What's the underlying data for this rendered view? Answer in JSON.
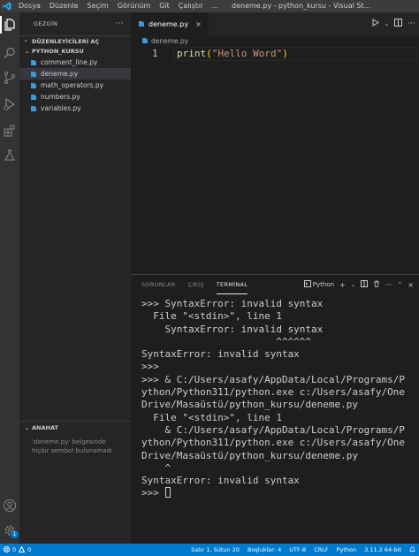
{
  "titlebar": {
    "menu": [
      "Dosya",
      "Düzenle",
      "Seçim",
      "Görünüm",
      "Git",
      "Çalıştır",
      "..."
    ],
    "window_title": "deneme.py - python_kursu - Visual St..."
  },
  "activity": {
    "icons": [
      "files-icon",
      "search-icon",
      "source-control-icon",
      "run-debug-icon",
      "extensions-icon",
      "testing-icon"
    ],
    "bottom_icons": [
      "account-icon",
      "settings-icon"
    ],
    "settings_badge": "1"
  },
  "sidebar": {
    "title": "GEZGİN",
    "more": "···",
    "open_editors": "DÜZENLEYİCİLERİ AÇ",
    "folder": "PYTHON_KURSU",
    "files": [
      "comment_line.py",
      "deneme.py",
      "math_operators.py",
      "numbers.py",
      "variables.py"
    ],
    "active_index": 1,
    "outline": {
      "title": "ANAHAT",
      "message": "'deneme.py' belgesinde hiçbir sembol bulunamadı"
    }
  },
  "editor": {
    "tab": "deneme.py",
    "tab_close": "×",
    "breadcrumb": "deneme.py",
    "line_number": "1",
    "code": {
      "fn": "print",
      "open": "(",
      "str": "\"Hello Word\"",
      "close": ")"
    }
  },
  "panel": {
    "tabs": [
      "SORUNLAR",
      "ÇIKIŞ",
      "TERMİNAL"
    ],
    "active_tab": 2,
    "shell": "Python",
    "terminal_lines": [
      ">>> SyntaxError: invalid syntax",
      "  File \"<stdin>\", line 1",
      "    SyntaxError: invalid syntax",
      "                       ^^^^^^",
      "SyntaxError: invalid syntax",
      ">>>",
      ">>> & C:/Users/asafy/AppData/Local/Programs/P",
      "ython/Python311/python.exe c:/Users/asafy/One",
      "Drive/Masaüstü/python_kursu/deneme.py",
      "  File \"<stdin>\", line 1",
      "    & C:/Users/asafy/AppData/Local/Programs/P",
      "ython/Python311/python.exe c:/Users/asafy/One",
      "Drive/Masaüstü/python_kursu/deneme.py",
      "    ^",
      "SyntaxError: invalid syntax"
    ],
    "prompt": ">>> "
  },
  "status": {
    "errors": "0",
    "warnings": "0",
    "position": "Satır 1, Sütun 20",
    "spaces": "Boşluklar: 4",
    "encoding": "UTF-8",
    "eol": "CRLF",
    "language": "Python",
    "interpreter": "3.11.2 64-bit"
  },
  "colors": {
    "accent": "#007acc",
    "python_icon": "#3b9bd7"
  }
}
